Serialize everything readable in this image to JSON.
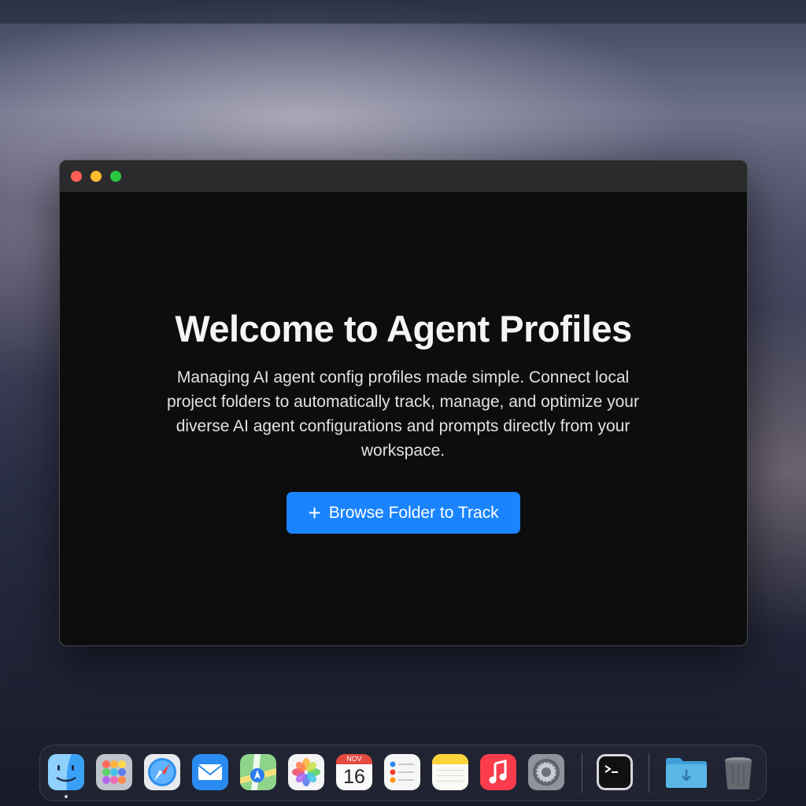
{
  "window": {
    "title": "Welcome to Agent Profiles",
    "description": "Managing AI agent config profiles made simple. Connect local project folders to automatically track, manage, and optimize your diverse AI agent configurations and prompts directly from your workspace.",
    "cta_label": "Browse Folder to Track",
    "cta_icon": "+"
  },
  "dock": {
    "items": [
      {
        "name": "finder-icon"
      },
      {
        "name": "launchpad-icon"
      },
      {
        "name": "safari-icon"
      },
      {
        "name": "mail-icon"
      },
      {
        "name": "maps-icon"
      },
      {
        "name": "photos-icon"
      },
      {
        "name": "calendar-icon",
        "month": "NOV",
        "day": "16"
      },
      {
        "name": "reminders-icon"
      },
      {
        "name": "notes-icon"
      },
      {
        "name": "music-icon"
      },
      {
        "name": "system-settings-icon"
      },
      {
        "name": "terminal-icon"
      },
      {
        "name": "downloads-folder-icon"
      },
      {
        "name": "trash-icon"
      }
    ]
  },
  "colors": {
    "accent": "#1a84ff",
    "window_bg": "#0d0d0e",
    "titlebar": "#2b2b2d"
  }
}
